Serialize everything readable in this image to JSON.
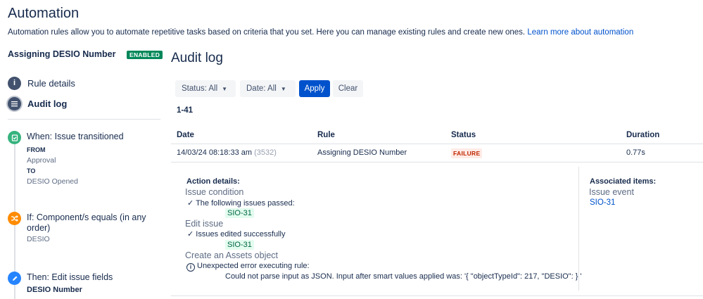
{
  "page": {
    "title": "Automation",
    "description": "Automation rules allow you to automate repetitive tasks based on criteria that you set. Here you can manage existing rules and create new ones.",
    "learn_more": "Learn more about automation"
  },
  "sidebar": {
    "rule_name": "Assigning DESIO Number",
    "status_badge": "ENABLED",
    "nav": [
      {
        "label": "Rule details",
        "icon": "info-icon"
      },
      {
        "label": "Audit log",
        "icon": "list-icon"
      }
    ],
    "steps": {
      "trigger": {
        "title": "When: Issue transitioned",
        "from_label": "FROM",
        "from_value": "Approval",
        "to_label": "TO",
        "to_value": "DESIO Opened",
        "icon": "trigger-icon",
        "color": "#36b37e"
      },
      "condition": {
        "title": "If: Component/s equals (in any order)",
        "value": "DESIO",
        "icon": "shuffle-icon",
        "color": "#ff8b00"
      },
      "action": {
        "title": "Then: Edit issue fields",
        "value": "DESIO Number",
        "icon": "pencil-icon",
        "color": "#2684ff"
      }
    }
  },
  "main": {
    "title": "Audit log",
    "filters": {
      "status": "Status: All",
      "date": "Date: All",
      "apply": "Apply",
      "clear": "Clear"
    },
    "range": "1-41",
    "table": {
      "headers": [
        "Date",
        "Rule",
        "Status",
        "Duration"
      ],
      "row": {
        "date": "14/03/24 08:18:33 am",
        "id": "(3532)",
        "rule": "Assigning DESIO Number",
        "status": "FAILURE",
        "duration": "0.77s"
      }
    },
    "details": {
      "action_details_label": "Action details:",
      "issue_condition": "Issue condition",
      "issues_passed": "✓ The following issues passed:",
      "issue_key_1": "SIO-31",
      "edit_issue": "Edit issue",
      "edited_success": "✓ Issues edited successfully",
      "issue_key_2": "SIO-31",
      "create_assets": "Create an Assets object",
      "error_title": "Unexpected error executing rule:",
      "error_detail": "Could not parse input as JSON. Input after smart values applied was: '{ \"objectTypeId\": 217, \"DESIO\": } '",
      "associated_label": "Associated items:",
      "issue_event": "Issue event",
      "associated_key": "SIO-31"
    }
  },
  "colors": {
    "primary": "#0052cc",
    "success": "#00875a",
    "failure_bg": "#ffebe6",
    "failure_text": "#bf2600"
  }
}
